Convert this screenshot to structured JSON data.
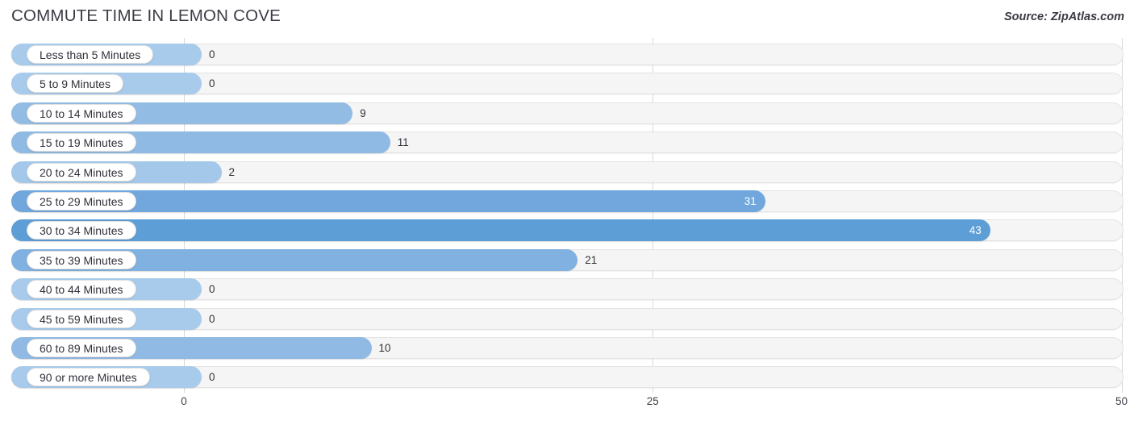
{
  "header": {
    "title": "COMMUTE TIME IN LEMON COVE",
    "source": "Source: ZipAtlas.com"
  },
  "colors": {
    "bar_light": "#a8cbec",
    "bar_mid": "#93bce4",
    "bar_strong": "#76aade",
    "bar_dark": "#5e9ed6",
    "track": "#f5f5f5",
    "gridline": "#d8d8d8",
    "title": "#3c3c46"
  },
  "chart_data": {
    "type": "bar",
    "orientation": "horizontal",
    "title": "COMMUTE TIME IN LEMON COVE",
    "xlabel": "",
    "ylabel": "",
    "xlim": [
      0,
      50
    ],
    "xticks": [
      0,
      25,
      50
    ],
    "xtick_labels": [
      "0",
      "25",
      "50"
    ],
    "grid": true,
    "legend": false,
    "categories": [
      "Less than 5 Minutes",
      "5 to 9 Minutes",
      "10 to 14 Minutes",
      "15 to 19 Minutes",
      "20 to 24 Minutes",
      "25 to 29 Minutes",
      "30 to 34 Minutes",
      "35 to 39 Minutes",
      "40 to 44 Minutes",
      "45 to 59 Minutes",
      "60 to 89 Minutes",
      "90 or more Minutes"
    ],
    "values": [
      0,
      0,
      9,
      11,
      2,
      31,
      43,
      21,
      0,
      0,
      10,
      0
    ],
    "value_labels": [
      "0",
      "0",
      "9",
      "11",
      "2",
      "31",
      "43",
      "21",
      "0",
      "0",
      "10",
      "0"
    ]
  },
  "rows": [
    {
      "label": "Less than 5 Minutes",
      "value": 0,
      "value_label": "0",
      "color": "#a8cbec",
      "inside": false
    },
    {
      "label": "5 to 9 Minutes",
      "value": 0,
      "value_label": "0",
      "color": "#a8cbec",
      "inside": false
    },
    {
      "label": "10 to 14 Minutes",
      "value": 9,
      "value_label": "9",
      "color": "#93bce4",
      "inside": false
    },
    {
      "label": "15 to 19 Minutes",
      "value": 11,
      "value_label": "11",
      "color": "#8fbae3",
      "inside": false
    },
    {
      "label": "20 to 24 Minutes",
      "value": 2,
      "value_label": "2",
      "color": "#a4c8ea",
      "inside": false
    },
    {
      "label": "25 to 29 Minutes",
      "value": 31,
      "value_label": "31",
      "color": "#71a7dd",
      "inside": true
    },
    {
      "label": "30 to 34 Minutes",
      "value": 43,
      "value_label": "43",
      "color": "#5e9ed6",
      "inside": true
    },
    {
      "label": "35 to 39 Minutes",
      "value": 21,
      "value_label": "21",
      "color": "#81b1e0",
      "inside": false
    },
    {
      "label": "40 to 44 Minutes",
      "value": 0,
      "value_label": "0",
      "color": "#a8cbec",
      "inside": false
    },
    {
      "label": "45 to 59 Minutes",
      "value": 0,
      "value_label": "0",
      "color": "#a8cbec",
      "inside": false
    },
    {
      "label": "60 to 89 Minutes",
      "value": 10,
      "value_label": "10",
      "color": "#90bae3",
      "inside": false
    },
    {
      "label": "90 or more Minutes",
      "value": 0,
      "value_label": "0",
      "color": "#a8cbec",
      "inside": false
    }
  ],
  "axis": {
    "ticks": [
      {
        "label": "0",
        "value": 0
      },
      {
        "label": "25",
        "value": 25
      },
      {
        "label": "50",
        "value": 50
      }
    ]
  }
}
